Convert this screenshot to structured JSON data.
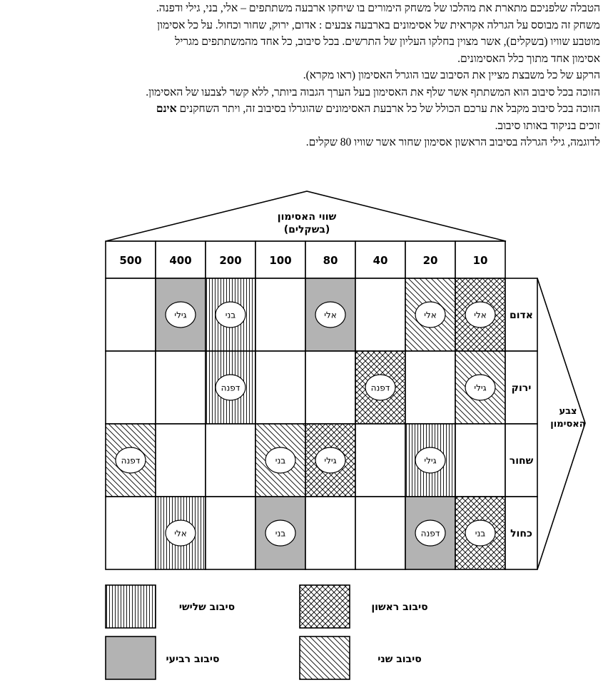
{
  "intro": {
    "lines": [
      "הטבלה שלפניכם מתארת את מהלכו של משחק הימורים בו שיחקו ארבעה משתתפים – אלי, בני, גילי ודפנה.",
      "משחק זה מבוסס על הגרלה אקראית של אסימונים בארבעה צבעים : אדום, ירוק, שחור וכחול. על כל אסימון",
      "מוטבע שוויו (בשקלים), אשר מצוין בחלקו העליון של התרשים. בכל סיבוב, כל אחד מהמשתתפים מגריל",
      "אסימון אחד מתוך כלל האסימונים.",
      "הרקע של כל משבצת מציין את הסיבוב שבו הוגרל האסימון (ראו מקרא).",
      "הזוכה בכל סיבוב הוא המשתתף אשר שלף את האסימון בעל הערך הגבוה ביותר, ללא קשר לצבעו של האסימון."
    ],
    "rule_line": {
      "before": "הזוכה בכל סיבוב מקבל את ערכם הכולל של כל ארבעת האסימונים שהוגרלו בסיבוב זה, ויתר השחקנים ",
      "bold": "אינם"
    },
    "tail_lines": [
      "זוכים בניקוד באותו סיבוב.",
      "לדוגמה, גילי הגרלה בסיבוב הראשון אסימון שחור אשר שוויו 80 שקלים."
    ]
  },
  "diagram": {
    "roof_title_line1": "שווי האסימון",
    "roof_title_line2": "(בשקלים)",
    "values": [
      "500",
      "400",
      "200",
      "100",
      "80",
      "40",
      "20",
      "10"
    ],
    "colors": [
      "אדום",
      "ירוק",
      "שחור",
      "כחול"
    ],
    "color_axis_line1": "צבע",
    "color_axis_line2": "האסימון",
    "cells": [
      {
        "row": 0,
        "col": 1,
        "name": "גילי",
        "round": "r4"
      },
      {
        "row": 0,
        "col": 2,
        "name": "בני",
        "round": "r3"
      },
      {
        "row": 0,
        "col": 4,
        "name": "אלי",
        "round": "r4"
      },
      {
        "row": 0,
        "col": 6,
        "name": "אלי",
        "round": "r2"
      },
      {
        "row": 0,
        "col": 7,
        "name": "אלי",
        "round": "r1"
      },
      {
        "row": 1,
        "col": 2,
        "name": "דפנה",
        "round": "r3"
      },
      {
        "row": 1,
        "col": 5,
        "name": "דפנה",
        "round": "r1"
      },
      {
        "row": 1,
        "col": 7,
        "name": "גילי",
        "round": "r2"
      },
      {
        "row": 2,
        "col": 0,
        "name": "דפנה",
        "round": "r2"
      },
      {
        "row": 2,
        "col": 3,
        "name": "בני",
        "round": "r2"
      },
      {
        "row": 2,
        "col": 4,
        "name": "גילי",
        "round": "r1"
      },
      {
        "row": 2,
        "col": 6,
        "name": "גילי",
        "round": "r3"
      },
      {
        "row": 3,
        "col": 1,
        "name": "אלי",
        "round": "r3"
      },
      {
        "row": 3,
        "col": 3,
        "name": "בני",
        "round": "r4"
      },
      {
        "row": 3,
        "col": 6,
        "name": "דפנה",
        "round": "r4"
      },
      {
        "row": 3,
        "col": 7,
        "name": "בני",
        "round": "r1"
      }
    ],
    "legend": [
      {
        "round": "r3",
        "label": "סיבוב שלישי"
      },
      {
        "round": "r1",
        "label": "סיבוב ראשון"
      },
      {
        "round": "r4",
        "label": "סיבוב רביעי"
      },
      {
        "round": "r2",
        "label": "סיבוב שני"
      }
    ]
  }
}
